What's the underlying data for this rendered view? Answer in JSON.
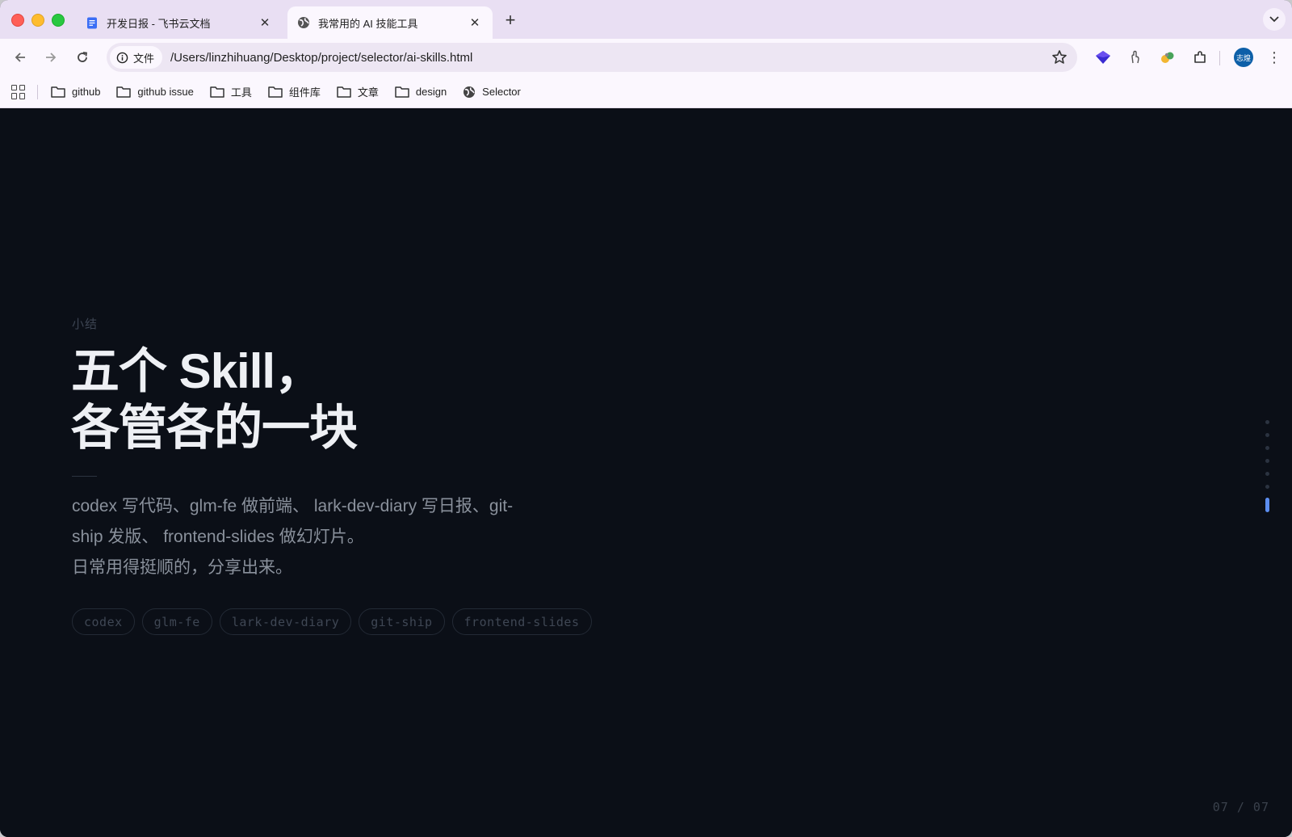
{
  "browser": {
    "tabs": [
      {
        "title": "开发日报 - 飞书云文档",
        "active": false,
        "favicon": "document-icon"
      },
      {
        "title": "我常用的 AI 技能工具",
        "active": true,
        "favicon": "globe-icon"
      }
    ],
    "new_tab_label": "+",
    "address": {
      "chip_label": "文件",
      "url": "/Users/linzhihuang/Desktop/project/selector/ai-skills.html"
    },
    "profile_initials": "志煌",
    "bookmarks": [
      {
        "label": "github",
        "icon": "folder-icon"
      },
      {
        "label": "github issue",
        "icon": "folder-icon"
      },
      {
        "label": "工具",
        "icon": "folder-icon"
      },
      {
        "label": "组件库",
        "icon": "folder-icon"
      },
      {
        "label": "文章",
        "icon": "folder-icon"
      },
      {
        "label": "design",
        "icon": "folder-icon"
      },
      {
        "label": "Selector",
        "icon": "globe-icon"
      }
    ]
  },
  "slide": {
    "eyebrow": "小结",
    "headline_line1": "五个 Skill，",
    "headline_line2": "各管各的一块",
    "body_line1": "codex 写代码、glm-fe 做前端、 lark-dev-diary 写日报、git-",
    "body_line2": "ship 发版、 frontend-slides 做幻灯片。",
    "body_line3": "日常用得挺顺的，分享出来。",
    "tags": [
      "codex",
      "glm-fe",
      "lark-dev-diary",
      "git-ship",
      "frontend-slides"
    ],
    "counter": "07 / 07",
    "current_slide": 7,
    "total_slides": 7
  },
  "colors": {
    "page_bg": "#0b0f17",
    "accent": "#5b8def",
    "tab_strip": "#e9dff3"
  }
}
